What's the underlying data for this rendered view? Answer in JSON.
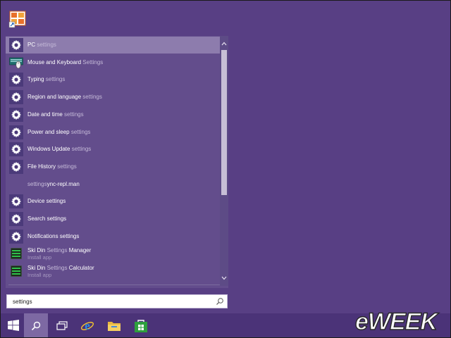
{
  "desktop": {
    "icon": "office-app-icon"
  },
  "results": [
    {
      "icon": "gear-icon",
      "main": "PC",
      "dim": " settings",
      "sub": "",
      "selected": true
    },
    {
      "icon": "keyboard-mouse-icon",
      "main": "Mouse and Keyboard",
      "dim": " Settings",
      "sub": ""
    },
    {
      "icon": "gear-icon",
      "main": "Typing",
      "dim": " settings",
      "sub": ""
    },
    {
      "icon": "gear-icon",
      "main": "Region and language",
      "dim": " settings",
      "sub": ""
    },
    {
      "icon": "gear-icon",
      "main": "Date and time",
      "dim": " settings",
      "sub": ""
    },
    {
      "icon": "gear-icon",
      "main": "Power and sleep",
      "dim": " settings",
      "sub": ""
    },
    {
      "icon": "gear-icon",
      "main": "Windows Update",
      "dim": " settings",
      "sub": ""
    },
    {
      "icon": "gear-icon",
      "main": "File History",
      "dim": " settings",
      "sub": ""
    },
    {
      "icon": "none",
      "main": "",
      "dim": "settings",
      "main2": "ync-repl.man",
      "sub": ""
    },
    {
      "icon": "gear-icon",
      "main": "Device settings",
      "dim": "",
      "sub": ""
    },
    {
      "icon": "gear-icon",
      "main": "Search settings",
      "dim": "",
      "sub": ""
    },
    {
      "icon": "gear-icon",
      "main": "Notifications settings",
      "dim": "",
      "sub": ""
    },
    {
      "icon": "app-tile-icon",
      "main": "Ski Din ",
      "dim": "Settings",
      "main2": " Manager",
      "sub": "Install app"
    },
    {
      "icon": "app-tile-icon",
      "main": "Ski Din ",
      "dim": "Settings",
      "main2": " Calculator",
      "sub": "Install app"
    }
  ],
  "search": {
    "value": "settings"
  },
  "taskbar": {
    "items": [
      "windows-start-icon",
      "search-icon",
      "task-view-icon",
      "internet-explorer-icon",
      "file-explorer-icon",
      "store-icon"
    ]
  },
  "watermark": {
    "text": "eWEEK"
  },
  "colors": {
    "desktop": "#583f84",
    "panel": "#634d8c",
    "selected": "#8d7cad",
    "taskbar": "#4b3378"
  }
}
